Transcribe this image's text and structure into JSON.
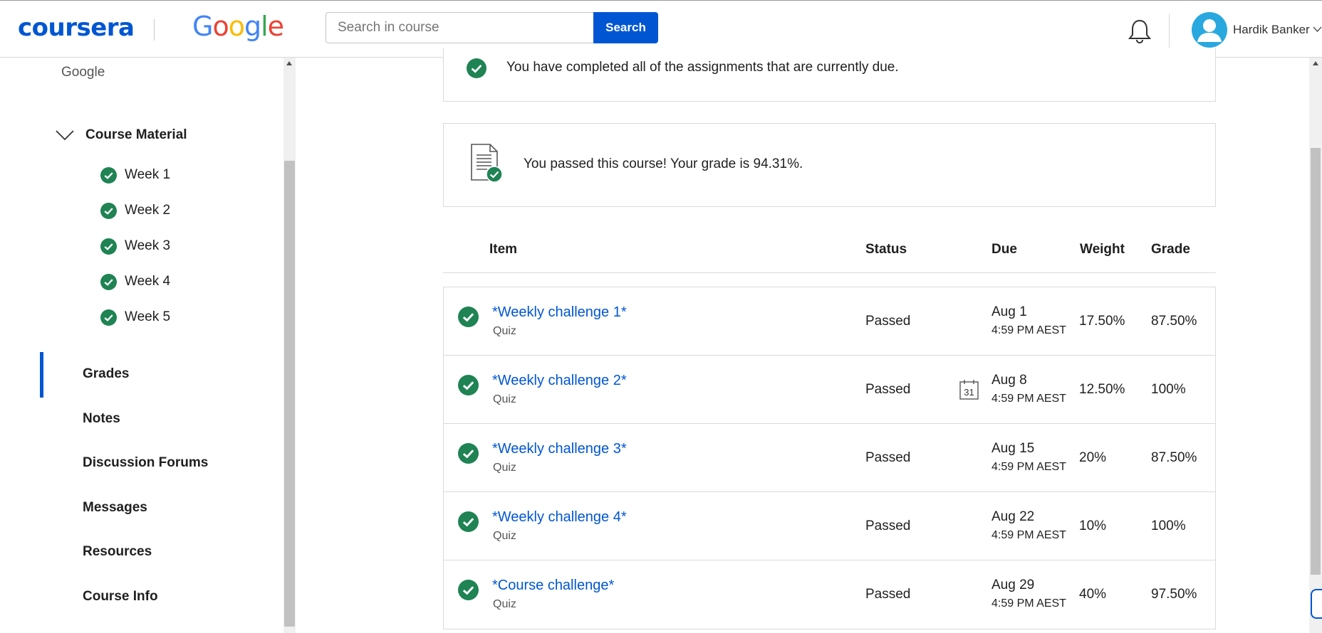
{
  "header": {
    "logo": "coursera",
    "partner_logo": "Google",
    "search_placeholder": "Search in course",
    "search_button": "Search",
    "user_name": "Hardik Banker",
    "brand_color": "#0056d2"
  },
  "sidebar": {
    "course_org": "Google",
    "course_material_label": "Course Material",
    "weeks": [
      "Week 1",
      "Week 2",
      "Week 3",
      "Week 4",
      "Week 5"
    ],
    "nav": [
      "Grades",
      "Notes",
      "Discussion Forums",
      "Messages",
      "Resources",
      "Course Info"
    ],
    "active_nav": "Grades"
  },
  "main": {
    "status_message": "You have completed all of the assignments that are currently due.",
    "passed_message": "You passed this course! Your grade is 94.31%.",
    "table": {
      "columns": [
        "Item",
        "Status",
        "Due",
        "Weight",
        "Grade"
      ],
      "rows": [
        {
          "title": "*Weekly challenge 1*",
          "type": "Quiz",
          "status": "Passed",
          "due_date": "Aug 1",
          "due_time": "4:59 PM AEST",
          "weight": "17.50%",
          "grade": "87.50%"
        },
        {
          "title": "*Weekly challenge 2*",
          "type": "Quiz",
          "status": "Passed",
          "due_date": "Aug 8",
          "due_time": "4:59 PM AEST",
          "weight": "12.50%",
          "grade": "100%",
          "calendar_day": "31"
        },
        {
          "title": "*Weekly challenge 3*",
          "type": "Quiz",
          "status": "Passed",
          "due_date": "Aug 15",
          "due_time": "4:59 PM AEST",
          "weight": "20%",
          "grade": "87.50%"
        },
        {
          "title": "*Weekly challenge 4*",
          "type": "Quiz",
          "status": "Passed",
          "due_date": "Aug 22",
          "due_time": "4:59 PM AEST",
          "weight": "10%",
          "grade": "100%"
        },
        {
          "title": "*Course challenge*",
          "type": "Quiz",
          "status": "Passed",
          "due_date": "Aug 29",
          "due_time": "4:59 PM AEST",
          "weight": "40%",
          "grade": "97.50%"
        }
      ]
    },
    "success_color": "#1f8354"
  }
}
